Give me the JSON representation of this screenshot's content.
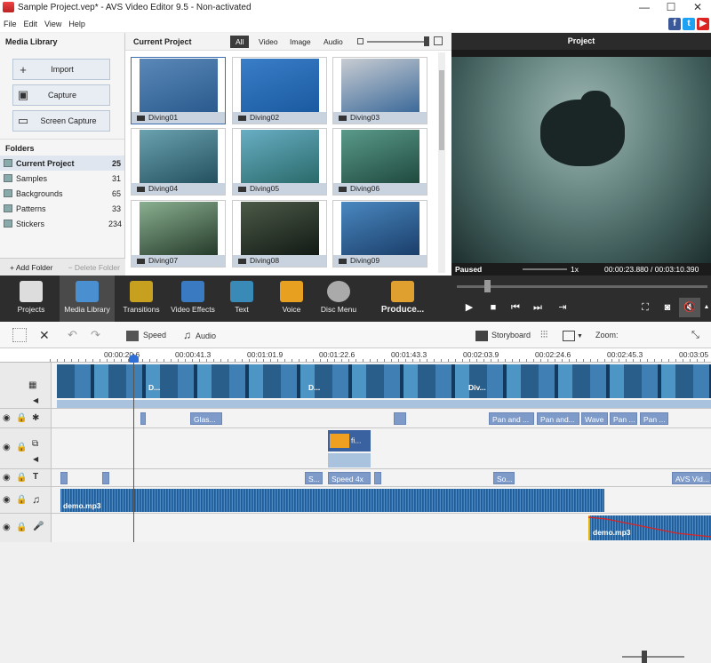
{
  "window": {
    "title": "Sample Project.vep* - AVS Video Editor 9.5 - Non-activated"
  },
  "menu": [
    "File",
    "Edit",
    "View",
    "Help"
  ],
  "social": [
    "f",
    "t",
    "▶"
  ],
  "library": {
    "header": "Media Library",
    "buttons": [
      "Import",
      "Capture",
      "Screen Capture"
    ],
    "folders_header": "Folders",
    "folders": [
      {
        "name": "Current Project",
        "count": "25"
      },
      {
        "name": "Samples",
        "count": "31"
      },
      {
        "name": "Backgrounds",
        "count": "65"
      },
      {
        "name": "Patterns",
        "count": "33"
      },
      {
        "name": "Stickers",
        "count": "234"
      }
    ],
    "add_folder": "+ Add Folder",
    "delete_folder": "− Delete Folder"
  },
  "project": {
    "header": "Current Project",
    "filters": [
      "All",
      "Video",
      "Image",
      "Audio"
    ],
    "clips": [
      "Diving01",
      "Diving02",
      "Diving03",
      "Diving04",
      "Diving05",
      "Diving06",
      "Diving07",
      "Diving08",
      "Diving09"
    ]
  },
  "preview": {
    "header": "Project",
    "status": "Paused",
    "speed": "1x",
    "time": "00:00:23.880 / 00:03:10.390"
  },
  "toolbar": [
    "Projects",
    "Media Library",
    "Transitions",
    "Video Effects",
    "Text",
    "Voice",
    "Disc Menu",
    "Produce..."
  ],
  "timeline_tools": {
    "speed": "Speed",
    "audio": "Audio",
    "storyboard": "Storyboard",
    "zoom": "Zoom:"
  },
  "ruler": [
    "00:00:20.6",
    "00:00:41.3",
    "00:01:01.9",
    "00:01:22.6",
    "00:01:43.3",
    "00:02:03.9",
    "00:02:24.6",
    "00:02:45.3",
    "00:03:05"
  ],
  "effects": [
    "Glas...",
    "Pan and ...",
    "Pan and...",
    "Wave",
    "Pan ..."
  ],
  "overlay": [
    "fi..."
  ],
  "text_clips": [
    "S...",
    "Speed 4x",
    "So...",
    "AVS Vid..."
  ],
  "audio": [
    "demo.mp3",
    "demo.mp3"
  ],
  "video_labels": [
    "D...",
    "D...",
    "Div..."
  ]
}
